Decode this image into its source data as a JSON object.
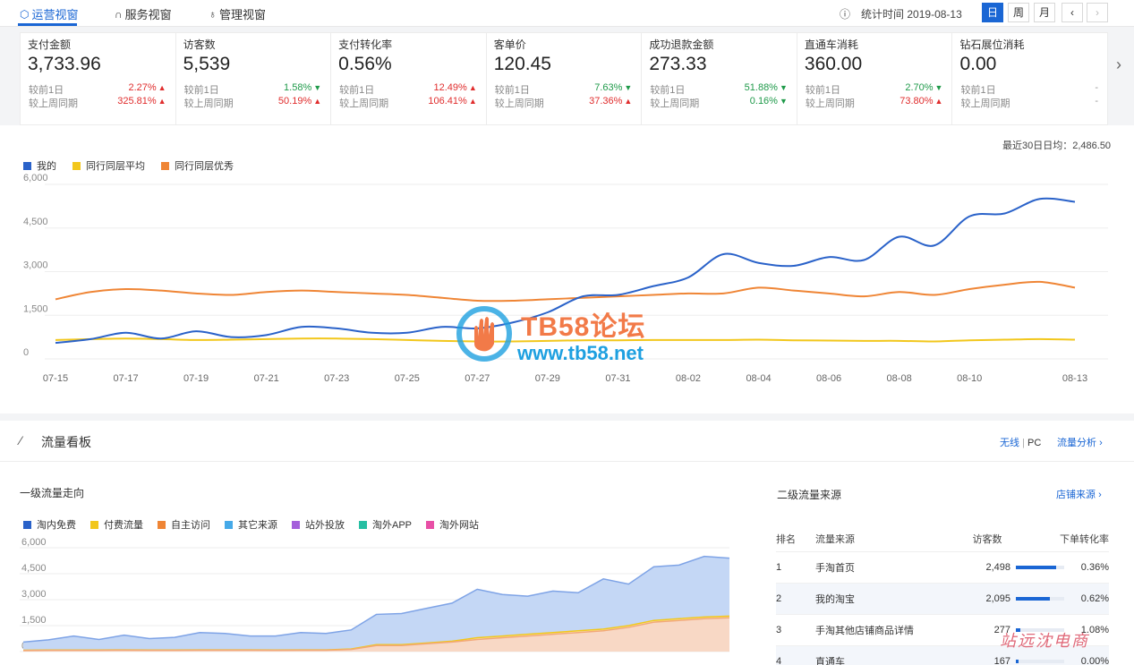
{
  "tabs": [
    {
      "label": "运营视窗",
      "icon": "ops-view-icon",
      "active": true
    },
    {
      "label": "服务视窗",
      "icon": "headset-icon",
      "active": false
    },
    {
      "label": "管理视窗",
      "icon": "bag-icon",
      "active": false
    }
  ],
  "stat_time": {
    "label": "统计时间",
    "date": "2019-08-13"
  },
  "period_buttons": [
    "日",
    "周",
    "月"
  ],
  "metrics": [
    {
      "label": "支付金额",
      "value": "3,733.96",
      "prev_day_label": "较前1日",
      "prev_day": "2.27%",
      "prev_day_dir": "up",
      "prev_week_label": "较上周同期",
      "prev_week": "325.81%",
      "prev_week_dir": "up"
    },
    {
      "label": "访客数",
      "value": "5,539",
      "prev_day_label": "较前1日",
      "prev_day": "1.58%",
      "prev_day_dir": "down",
      "prev_week_label": "较上周同期",
      "prev_week": "50.19%",
      "prev_week_dir": "up"
    },
    {
      "label": "支付转化率",
      "value": "0.56%",
      "prev_day_label": "较前1日",
      "prev_day": "12.49%",
      "prev_day_dir": "up",
      "prev_week_label": "较上周同期",
      "prev_week": "106.41%",
      "prev_week_dir": "up"
    },
    {
      "label": "客单价",
      "value": "120.45",
      "prev_day_label": "较前1日",
      "prev_day": "7.63%",
      "prev_day_dir": "down",
      "prev_week_label": "较上周同期",
      "prev_week": "37.36%",
      "prev_week_dir": "up"
    },
    {
      "label": "成功退款金额",
      "value": "273.33",
      "prev_day_label": "较前1日",
      "prev_day": "51.88%",
      "prev_day_dir": "down",
      "prev_week_label": "较上周同期",
      "prev_week": "0.16%",
      "prev_week_dir": "down"
    },
    {
      "label": "直通车消耗",
      "value": "360.00",
      "prev_day_label": "较前1日",
      "prev_day": "2.70%",
      "prev_day_dir": "down",
      "prev_week_label": "较上周同期",
      "prev_week": "73.80%",
      "prev_week_dir": "up"
    },
    {
      "label": "钻石展位消耗",
      "value": "0.00",
      "prev_day_label": "较前1日",
      "prev_day": "-",
      "prev_day_dir": "none",
      "prev_week_label": "较上周同期",
      "prev_week": "-",
      "prev_week_dir": "none"
    }
  ],
  "avg_text": "最近30日日均：2,486.50",
  "watermark": {
    "brand": "TB58论坛",
    "url": "www.tb58.net"
  },
  "colors": {
    "accent": "#1a66d4",
    "up": "#e02d2d",
    "down": "#1f9a4a",
    "mine": "#2a62c9",
    "peer_avg": "#f2c71c",
    "peer_top": "#ef8535"
  },
  "chart_data": [
    {
      "type": "line",
      "legend": [
        "我的",
        "同行同层平均",
        "同行同层优秀"
      ],
      "legend_position": "top-left",
      "x": [
        "07-15",
        "07-16",
        "07-17",
        "07-18",
        "07-19",
        "07-20",
        "07-21",
        "07-22",
        "07-23",
        "07-24",
        "07-25",
        "07-26",
        "07-27",
        "07-28",
        "07-29",
        "07-30",
        "07-31",
        "08-01",
        "08-02",
        "08-03",
        "08-04",
        "08-05",
        "08-06",
        "08-07",
        "08-08",
        "08-09",
        "08-10",
        "08-11",
        "08-12",
        "08-13"
      ],
      "x_tick_labels": [
        "07-15",
        "07-17",
        "07-19",
        "07-21",
        "07-23",
        "07-25",
        "07-27",
        "07-29",
        "07-31",
        "08-02",
        "08-04",
        "08-06",
        "08-08",
        "08-10",
        "08-13"
      ],
      "y_ticks": [
        "0",
        "1,500",
        "3,000",
        "4,500",
        "6,000"
      ],
      "ylim": [
        0,
        6000
      ],
      "series": [
        {
          "name": "我的",
          "color": "#2a62c9",
          "values": [
            550,
            680,
            900,
            700,
            950,
            750,
            820,
            1100,
            1050,
            900,
            900,
            1100,
            1050,
            1250,
            1600,
            2150,
            2200,
            2500,
            2800,
            3600,
            3300,
            3200,
            3500,
            3400,
            4200,
            3900,
            4900,
            5000,
            5500,
            5400
          ]
        },
        {
          "name": "同行同层平均",
          "color": "#f2c71c",
          "values": [
            650,
            680,
            700,
            680,
            650,
            660,
            680,
            700,
            700,
            680,
            650,
            620,
            600,
            600,
            620,
            640,
            640,
            650,
            650,
            650,
            660,
            640,
            630,
            620,
            620,
            600,
            640,
            660,
            680,
            660
          ]
        },
        {
          "name": "同行同层优秀",
          "color": "#ef8535",
          "values": [
            2050,
            2300,
            2400,
            2350,
            2250,
            2200,
            2300,
            2350,
            2300,
            2250,
            2200,
            2100,
            2000,
            2000,
            2050,
            2100,
            2150,
            2200,
            2250,
            2250,
            2450,
            2350,
            2250,
            2150,
            2300,
            2200,
            2400,
            2550,
            2650,
            2450
          ]
        }
      ],
      "grid": true
    },
    {
      "type": "area",
      "legend": [
        "淘内免费",
        "付费流量",
        "自主访问",
        "其它来源",
        "站外投放",
        "淘外APP",
        "淘外网站"
      ],
      "legend_colors": [
        "#2a62c9",
        "#f2c71c",
        "#ef8535",
        "#45a9e8",
        "#a45fdb",
        "#26bfa3",
        "#e84fa6"
      ],
      "legend_position": "top-left",
      "y_ticks": [
        "0",
        "1,500",
        "3,000",
        "4,500",
        "6,000"
      ],
      "ylim": [
        0,
        6000
      ],
      "series": [
        {
          "name": "淘内免费",
          "values": [
            550,
            680,
            900,
            700,
            950,
            750,
            820,
            1100,
            1050,
            900,
            900,
            1100,
            1050,
            1250,
            2150,
            2200,
            2500,
            2800,
            3600,
            3300,
            3200,
            3500,
            3400,
            4200,
            3900,
            4900,
            5000,
            5500,
            5400
          ]
        },
        {
          "name": "付费流量",
          "values": [
            80,
            90,
            90,
            90,
            100,
            90,
            90,
            100,
            100,
            100,
            90,
            100,
            100,
            150,
            400,
            400,
            500,
            600,
            800,
            900,
            1000,
            1100,
            1200,
            1300,
            1500,
            1800,
            1900,
            2000,
            2050
          ]
        },
        {
          "name": "自主访问",
          "values": [
            60,
            70,
            70,
            70,
            80,
            70,
            70,
            80,
            80,
            80,
            70,
            80,
            80,
            120,
            350,
            350,
            450,
            550,
            700,
            800,
            900,
            1000,
            1100,
            1200,
            1400,
            1700,
            1800,
            1900,
            1950
          ]
        }
      ]
    }
  ],
  "traffic": {
    "title": "流量看板",
    "wireless": "无线",
    "pc": "PC",
    "flow_analysis": "流量分析",
    "level1_title": "一级流量走向",
    "level2_title": "二级流量来源",
    "shop_source": "店铺来源",
    "table_headers": [
      "排名",
      "流量来源",
      "访客数",
      "下单转化率"
    ],
    "rows": [
      {
        "rank": "1",
        "source": "手淘首页",
        "visitors": "2,498",
        "bar": 0.84,
        "rate": "0.36%"
      },
      {
        "rank": "2",
        "source": "我的淘宝",
        "visitors": "2,095",
        "bar": 0.7,
        "rate": "0.62%"
      },
      {
        "rank": "3",
        "source": "手淘其他店铺商品详情",
        "visitors": "277",
        "bar": 0.09,
        "rate": "1.08%"
      },
      {
        "rank": "4",
        "source": "直通车",
        "visitors": "167",
        "bar": 0.06,
        "rate": "0.00%"
      }
    ]
  },
  "signature": "站远沈电商"
}
